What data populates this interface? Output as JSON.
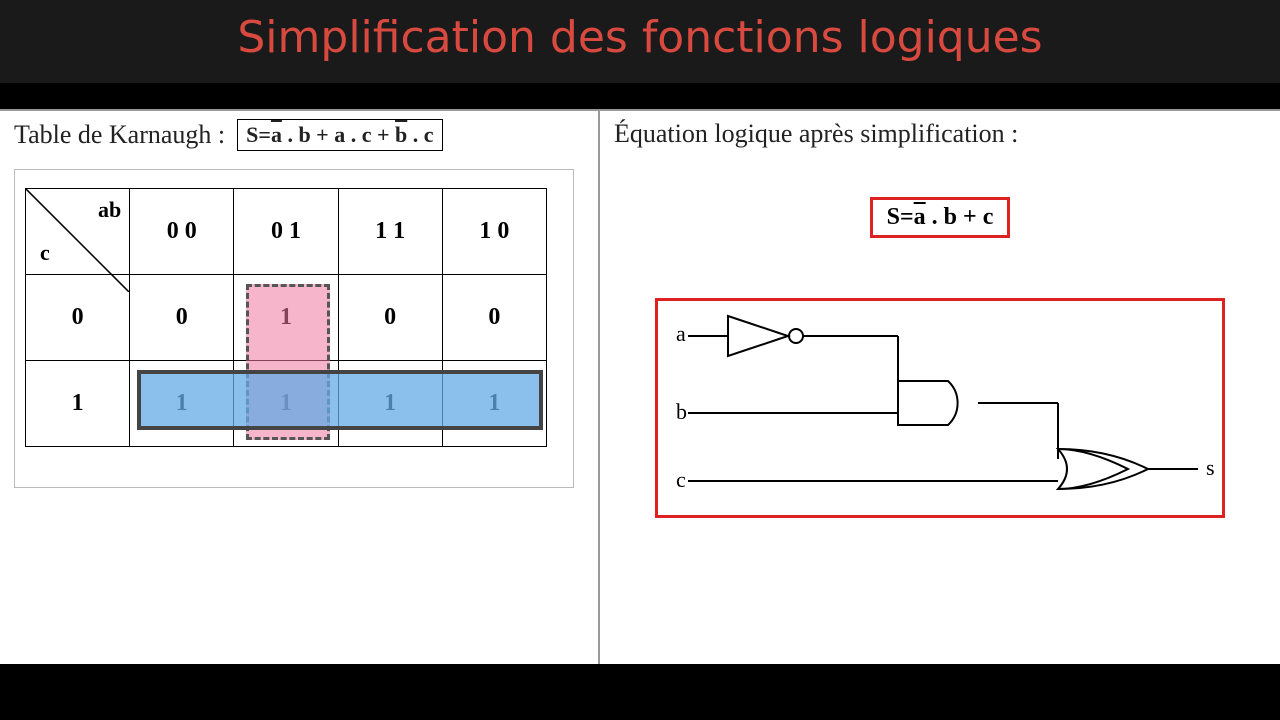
{
  "title": "Simplification des fonctions logiques",
  "left": {
    "heading": "Table de Karnaugh :",
    "equation_parts": {
      "lhs": "S=",
      "t1_var": "a",
      "t1_rest": " . b + a . c + ",
      "t2_var": "b",
      "t2_rest": " . c"
    },
    "kmap": {
      "col_var": "ab",
      "row_var": "c",
      "cols": [
        "0 0",
        "0 1",
        "1 1",
        "1 0"
      ],
      "rows": [
        "0",
        "1"
      ],
      "cells": [
        [
          "0",
          "1",
          "0",
          "0"
        ],
        [
          "1",
          "1",
          "1",
          "1"
        ]
      ]
    }
  },
  "right": {
    "heading": "Équation logique après simplification :",
    "equation": {
      "lhs": "S=",
      "var": "a",
      "rest": " . b + c"
    },
    "circuit": {
      "inputs": [
        "a",
        "b",
        "c"
      ],
      "output": "s"
    }
  }
}
